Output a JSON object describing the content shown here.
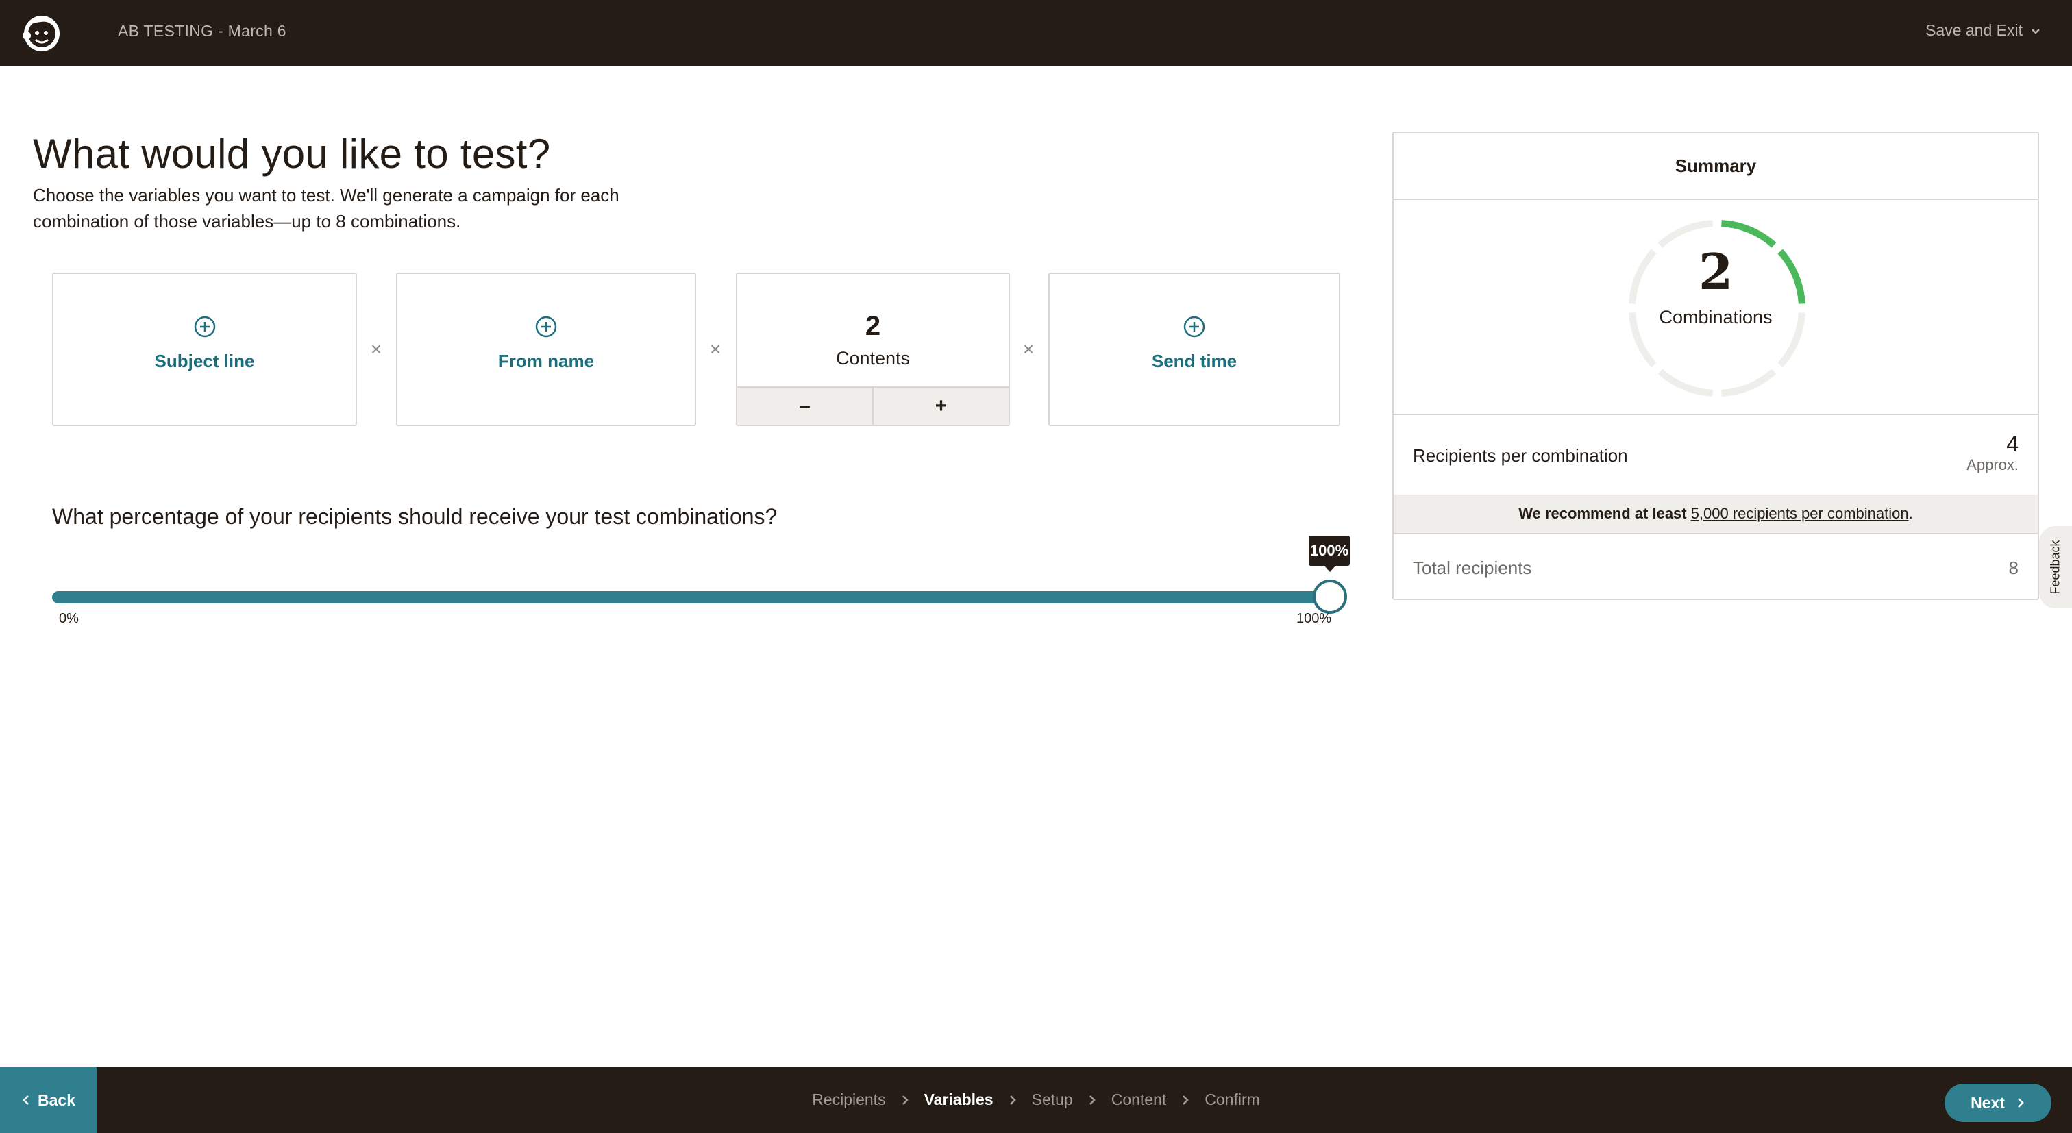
{
  "header": {
    "title": "AB TESTING - March 6",
    "save_exit_label": "Save and Exit"
  },
  "main": {
    "title": "What would you like to test?",
    "description": "Choose the variables you want to test. We'll generate a campaign for each combination of those variables—up to 8 combinations.",
    "variables": {
      "subject_line": "Subject line",
      "from_name": "From name",
      "contents_count": "2",
      "contents_label": "Contents",
      "decrement": "–",
      "increment": "+",
      "send_time": "Send time",
      "times_symbol": "×"
    },
    "percentage_question": "What percentage of your recipients should receive your test combinations?",
    "slider": {
      "value_label": "100%",
      "value_fraction": 1.0,
      "min_label": "0%",
      "max_label": "100%"
    }
  },
  "summary": {
    "title": "Summary",
    "combinations_count": "2",
    "combinations_label": "Combinations",
    "combinations_fraction": 0.25,
    "recipients_per_combination_label": "Recipients per combination",
    "recipients_per_combination_value": "4",
    "approx_label": "Approx.",
    "recommend_prefix": "We recommend at least",
    "recommend_link": "5,000 recipients per combination",
    "recommend_suffix": ".",
    "total_recipients_label": "Total recipients",
    "total_recipients_value": "8"
  },
  "feedback_label": "Feedback",
  "footer": {
    "back_label": "Back",
    "steps": [
      "Recipients",
      "Variables",
      "Setup",
      "Content",
      "Confirm"
    ],
    "active_step": "Variables",
    "next_label": "Next"
  },
  "colors": {
    "dark": "#241c15",
    "teal": "#307f8f",
    "green": "#4cb85c",
    "ring_gray": "#efeeea"
  },
  "icons": [
    "freddie-logo-icon",
    "chevron-down-icon",
    "plus-circle-icon",
    "chevron-left-icon",
    "chevron-right-icon"
  ]
}
